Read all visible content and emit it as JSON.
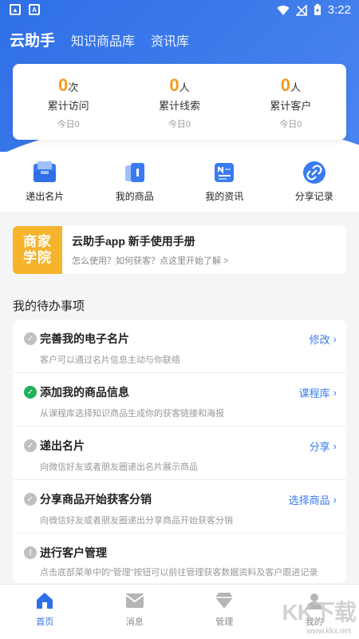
{
  "status_bar": {
    "time": "3:22"
  },
  "top_nav": {
    "items": [
      "云助手",
      "知识商品库",
      "资讯库"
    ]
  },
  "stats": [
    {
      "value": "0",
      "unit": "次",
      "label": "累计访问",
      "today": "今日0"
    },
    {
      "value": "0",
      "unit": "人",
      "label": "累计线索",
      "today": "今日0"
    },
    {
      "value": "0",
      "unit": "人",
      "label": "累计客户",
      "today": "今日0"
    }
  ],
  "quick_actions": [
    {
      "label": "递出名片",
      "icon": "card-tray-icon"
    },
    {
      "label": "我的商品",
      "icon": "product-icon"
    },
    {
      "label": "我的资讯",
      "icon": "news-icon"
    },
    {
      "label": "分享记录",
      "icon": "link-icon"
    }
  ],
  "banner": {
    "logo_line1": "商家",
    "logo_line2": "学院",
    "title": "云助手app 新手使用手册",
    "subtitle": "怎么使用？如何获客？点这里开始了解 >"
  },
  "todo_section_title": "我的待办事项",
  "todos": [
    {
      "title": "完善我的电子名片",
      "desc": "客户可以通过名片信息主动与你联络",
      "action": "修改",
      "state": "pending"
    },
    {
      "title": "添加我的商品信息",
      "desc": "从课程库选择知识商品生成你的获客链接和海报",
      "action": "课程库",
      "state": "done"
    },
    {
      "title": "递出名片",
      "desc": "向微信好友或者朋友圈递出名片展示商品",
      "action": "分享",
      "state": "pending"
    },
    {
      "title": "分享商品开始获客分销",
      "desc": "向微信好友或者朋友圈递出分享商品开始获客分销",
      "action": "选择商品",
      "state": "pending"
    },
    {
      "title": "进行客户管理",
      "desc": "点击底部菜单中的“管理”按钮可以前往管理获客数据资料及客户跟进记录",
      "action": "",
      "state": "info"
    }
  ],
  "tabbar": [
    {
      "label": "首页",
      "icon": "home-icon",
      "active": true
    },
    {
      "label": "消息",
      "icon": "mail-icon",
      "active": false
    },
    {
      "label": "管理",
      "icon": "diamond-icon",
      "active": false
    },
    {
      "label": "我的",
      "icon": "user-icon",
      "active": false
    }
  ],
  "watermark": {
    "text": "KK下载",
    "url": "www.kkx.net"
  },
  "colors": {
    "primary": "#2f6fe6",
    "accent": "#f39b1e",
    "done": "#20b15a",
    "pending": "#c0c0c0"
  }
}
